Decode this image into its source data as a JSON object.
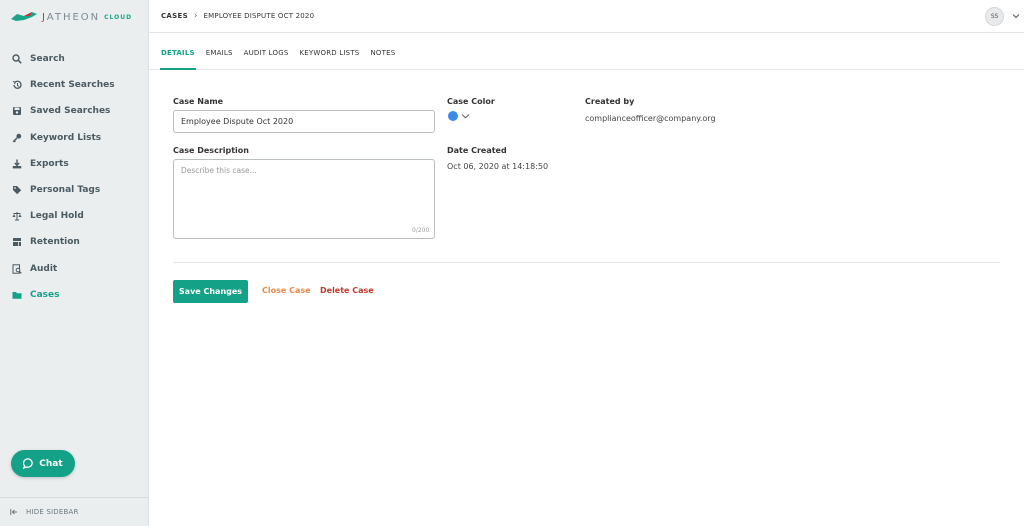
{
  "brand": {
    "name_prefix": "J",
    "name_rest": "ATHEON",
    "cloud_label": "CLOUD",
    "accent": "#13a288"
  },
  "sidebar": {
    "items": [
      {
        "label": "Search",
        "icon": "search-icon"
      },
      {
        "label": "Recent Searches",
        "icon": "history-icon"
      },
      {
        "label": "Saved Searches",
        "icon": "save-icon"
      },
      {
        "label": "Keyword Lists",
        "icon": "key-icon"
      },
      {
        "label": "Exports",
        "icon": "download-icon"
      },
      {
        "label": "Personal Tags",
        "icon": "tag-icon"
      },
      {
        "label": "Legal Hold",
        "icon": "scale-icon"
      },
      {
        "label": "Retention",
        "icon": "retention-icon"
      },
      {
        "label": "Audit",
        "icon": "audit-icon"
      },
      {
        "label": "Cases",
        "icon": "folder-icon",
        "active": true
      }
    ],
    "chat_label": "Chat",
    "hide_label": "HIDE SIDEBAR"
  },
  "header": {
    "breadcrumb_root": "CASES",
    "breadcrumb_current": "EMPLOYEE DISPUTE OCT 2020",
    "avatar_initials": "SS"
  },
  "tabs": [
    {
      "label": "DETAILS",
      "active": true
    },
    {
      "label": "EMAILS"
    },
    {
      "label": "AUDIT LOGS"
    },
    {
      "label": "KEYWORD LISTS"
    },
    {
      "label": "NOTES"
    }
  ],
  "form": {
    "case_name_label": "Case Name",
    "case_name_value": "Employee Dispute Oct 2020",
    "case_description_label": "Case Description",
    "case_description_placeholder": "Describe this case...",
    "case_description_counter": "0/200",
    "case_color_label": "Case Color",
    "case_color_value": "#3b8beb",
    "date_created_label": "Date Created",
    "date_created_value": "Oct 06, 2020 at 14:18:50",
    "created_by_label": "Created by",
    "created_by_value": "complianceofficer@company.org"
  },
  "actions": {
    "save_label": "Save Changes",
    "close_label": "Close Case",
    "delete_label": "Delete Case"
  }
}
